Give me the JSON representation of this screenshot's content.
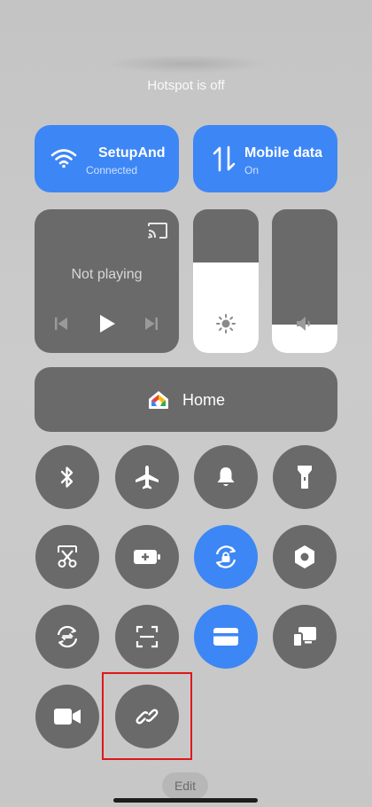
{
  "status": {
    "hotspot_text": "Hotspot is off"
  },
  "tiles": {
    "wifi": {
      "title": "SetupAndS",
      "subtitle": "Connected",
      "icon": "wifi-icon"
    },
    "mobile_data": {
      "title": "Mobile data",
      "subtitle": "On",
      "icon": "mobile-data-arrows-icon"
    }
  },
  "media": {
    "state_text": "Not playing"
  },
  "sliders": {
    "brightness": {
      "level": 0.63,
      "icon": "brightness-icon"
    },
    "volume": {
      "level": 0.2,
      "icon": "speaker-icon"
    }
  },
  "home": {
    "label": "Home",
    "icon": "google-home-icon"
  },
  "toggles": [
    {
      "name": "bluetooth",
      "icon": "bluetooth-icon",
      "active": false
    },
    {
      "name": "airplane-mode",
      "icon": "airplane-icon",
      "active": false
    },
    {
      "name": "ring-mode",
      "icon": "bell-icon",
      "active": false
    },
    {
      "name": "flashlight",
      "icon": "flashlight-icon",
      "active": false
    },
    {
      "name": "screenshot",
      "icon": "scissors-icon",
      "active": false
    },
    {
      "name": "battery-saver",
      "icon": "battery-icon",
      "active": false
    },
    {
      "name": "auto-rotate-lock",
      "icon": "rotation-lock-icon",
      "active": true
    },
    {
      "name": "settings",
      "icon": "hexagon-settings-icon",
      "active": false
    },
    {
      "name": "sync",
      "icon": "sync-icon",
      "active": false
    },
    {
      "name": "scanner",
      "icon": "scan-icon",
      "active": false
    },
    {
      "name": "wallet",
      "icon": "wallet-icon",
      "active": true
    },
    {
      "name": "cast-screen",
      "icon": "cast-device-icon",
      "active": false
    },
    {
      "name": "screen-recorder",
      "icon": "video-camera-icon",
      "active": false
    },
    {
      "name": "link",
      "icon": "link-icon",
      "active": false
    }
  ],
  "footer": {
    "edit_label": "Edit"
  },
  "colors": {
    "accent": "#3d86f5",
    "tile_gray": "#6a6a6a",
    "highlight": "#e0161b"
  }
}
